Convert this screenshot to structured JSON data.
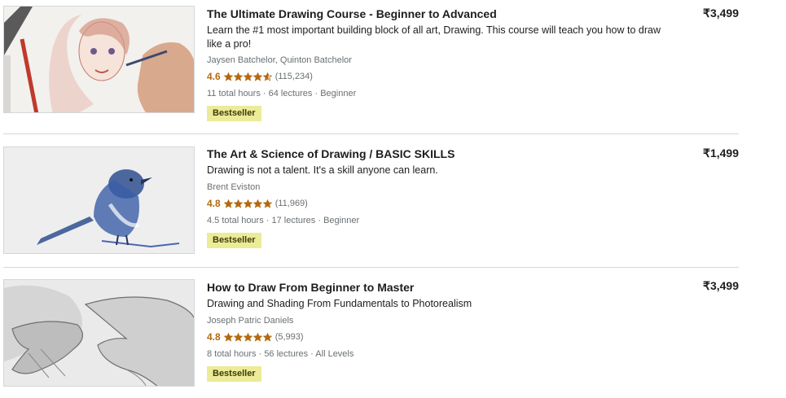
{
  "colors": {
    "rating": "#b4690e",
    "badge_bg": "#eceb98",
    "badge_text": "#3d3c0a",
    "divider": "#d1d7dc",
    "muted": "#6a6f73"
  },
  "courses": [
    {
      "title": "The Ultimate Drawing Course - Beginner to Advanced",
      "headline": "Learn the #1 most important building block of all art, Drawing. This course will teach you how to draw like a pro!",
      "instructors": "Jaysen Batchelor, Quinton Batchelor",
      "rating": "4.6",
      "rating_value": 4.6,
      "rating_count": "(115,234)",
      "meta": "11 total hours · 64 lectures · Beginner",
      "badge": "Bestseller",
      "price": "₹3,499",
      "thumbnail_icon": "girl-portrait-sketch-image"
    },
    {
      "title": "The Art & Science of Drawing / BASIC SKILLS",
      "headline": "Drawing is not a talent. It's a skill anyone can learn.",
      "instructors": "Brent Eviston",
      "rating": "4.8",
      "rating_value": 4.8,
      "rating_count": "(11,969)",
      "meta": "4.5 total hours · 17 lectures · Beginner",
      "badge": "Bestseller",
      "price": "₹1,499",
      "thumbnail_icon": "bird-sketch-image"
    },
    {
      "title": "How to Draw From Beginner to Master",
      "headline": "Drawing and Shading From Fundamentals to Photorealism",
      "instructors": "Joseph Patric Daniels",
      "rating": "4.8",
      "rating_value": 4.8,
      "rating_count": "(5,993)",
      "meta": "8 total hours · 56 lectures · All Levels",
      "badge": "Bestseller",
      "price": "₹3,499",
      "thumbnail_icon": "hands-sketch-image"
    }
  ]
}
